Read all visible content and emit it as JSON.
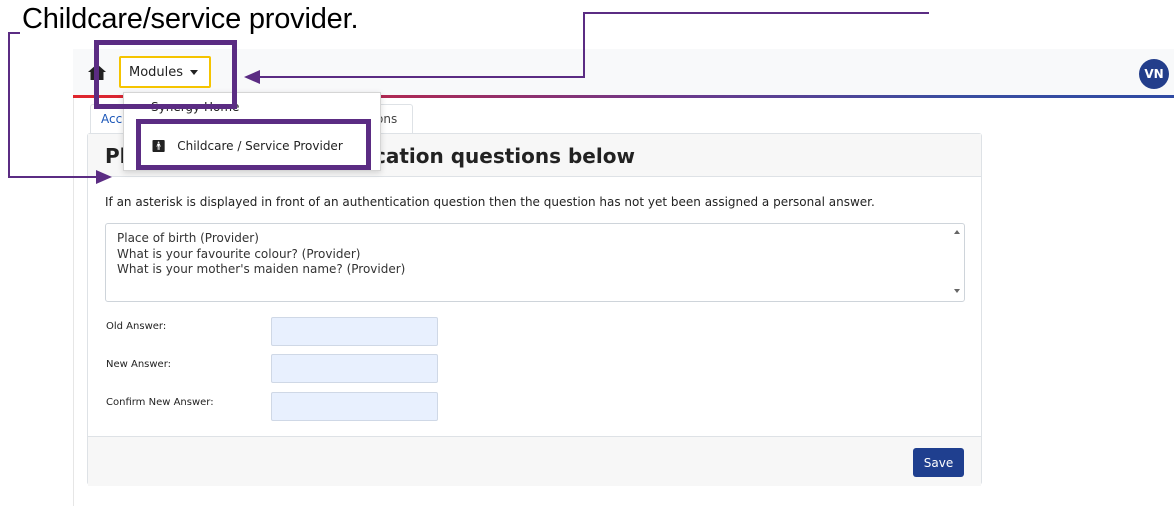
{
  "caption": "Childcare/service provider.",
  "topbar": {
    "modules_label": "Modules",
    "avatar_initials": "VN"
  },
  "dropdown": {
    "items": [
      {
        "label": "Synergy Home"
      },
      {
        "label": "Childcare / Service Provider",
        "icon": "person-icon"
      }
    ]
  },
  "tab": {
    "label_left": "Acc",
    "label_right": "ons"
  },
  "panel": {
    "title_left": "Pl",
    "title_right": "cation questions below",
    "info": "If an asterisk is displayed in front of an authentication question then the question has not yet been assigned a personal answer.",
    "questions": [
      "Place of birth (Provider)",
      "What is your favourite colour? (Provider)",
      "What is your mother's maiden name? (Provider)"
    ],
    "fields": {
      "old_label": "Old Answer:",
      "old_value": "",
      "new_label": "New Answer:",
      "new_value": "",
      "confirm_label": "Confirm New Answer:",
      "confirm_value": ""
    },
    "save_label": "Save"
  },
  "colors": {
    "annotation": "#5b2c83",
    "primary": "#1f3f8f",
    "highlight_border": "#f5c400"
  }
}
